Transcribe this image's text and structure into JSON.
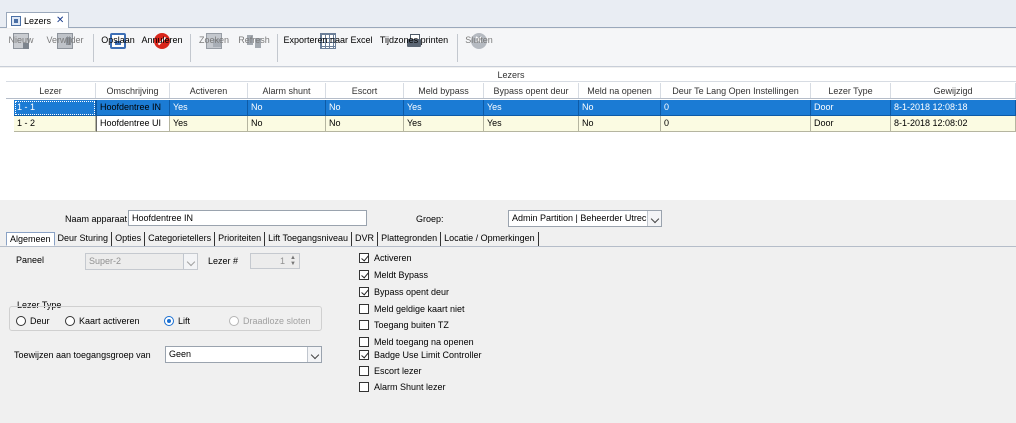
{
  "window": {
    "tab_title": "Lezers"
  },
  "toolbar": {
    "new": "Nieuw",
    "delete": "Verwijder",
    "save": "Opslaan",
    "cancel": "Annuleren",
    "search": "Zoeken",
    "refresh": "Refresh",
    "export": "Exporteren naar Excel",
    "print": "Tijdzones printen",
    "close": "Sluiten"
  },
  "grid": {
    "group_title": "Lezers",
    "columns": [
      "Lezer",
      "Omschrijving",
      "Activeren",
      "Alarm shunt",
      "Escort",
      "Meld bypass",
      "Bypass opent deur",
      "Meld na openen",
      "Deur Te Lang Open Instellingen",
      "Lezer Type",
      "Gewijzigd"
    ],
    "rows": [
      {
        "lezer": "1 - 1",
        "omschrijving": "Hoofdentree IN",
        "activeren": "Yes",
        "alarm_shunt": "No",
        "escort": "No",
        "meld_bypass": "Yes",
        "bypass_opent": "Yes",
        "meld_na_openen": "No",
        "deur_te_lang": "0",
        "lezer_type": "Door",
        "gewijzigd": "8-1-2018 12:08:18"
      },
      {
        "lezer": "1 - 2",
        "omschrijving": "Hoofdentree UI",
        "activeren": "Yes",
        "alarm_shunt": "No",
        "escort": "No",
        "meld_bypass": "Yes",
        "bypass_opent": "Yes",
        "meld_na_openen": "No",
        "deur_te_lang": "0",
        "lezer_type": "Door",
        "gewijzigd": "8-1-2018 12:08:02"
      }
    ]
  },
  "form": {
    "device_name_label": "Naam apparaat",
    "device_name_value": "Hoofdentree IN",
    "group_label": "Groep:",
    "group_value": "Admin Partition | Beheerder Utrech",
    "tabs": [
      "Algemeen",
      "Deur Sturing",
      "Opties",
      "Categorietellers",
      "Prioriteiten",
      "Lift Toegangsniveau",
      "DVR",
      "Plattegronden",
      "Locatie / Opmerkingen"
    ],
    "panel_label": "Paneel",
    "panel_value": "Super-2",
    "reader_num_label": "Lezer #",
    "reader_num_value": "1",
    "reader_type_label": "Lezer Type",
    "reader_type_options": [
      "Deur",
      "Kaart activeren",
      "Lift",
      "Draadloze sloten"
    ],
    "reader_type_selected": "Lift",
    "assign_label": "Toewijzen aan toegangsgroep van",
    "assign_value": "Geen",
    "checkboxes": [
      {
        "label": "Activeren",
        "checked": true
      },
      {
        "label": "Meldt Bypass",
        "checked": true
      },
      {
        "label": "Bypass opent deur",
        "checked": true
      },
      {
        "label": "Meld geldige kaart niet",
        "checked": false
      },
      {
        "label": "Toegang buiten TZ",
        "checked": false
      },
      {
        "label": "Meld toegang na openen",
        "checked": false
      },
      {
        "label": "Badge Use Limit Controller",
        "checked": true
      },
      {
        "label": "Escort lezer",
        "checked": false
      },
      {
        "label": "Alarm Shunt lezer",
        "checked": false
      }
    ]
  }
}
